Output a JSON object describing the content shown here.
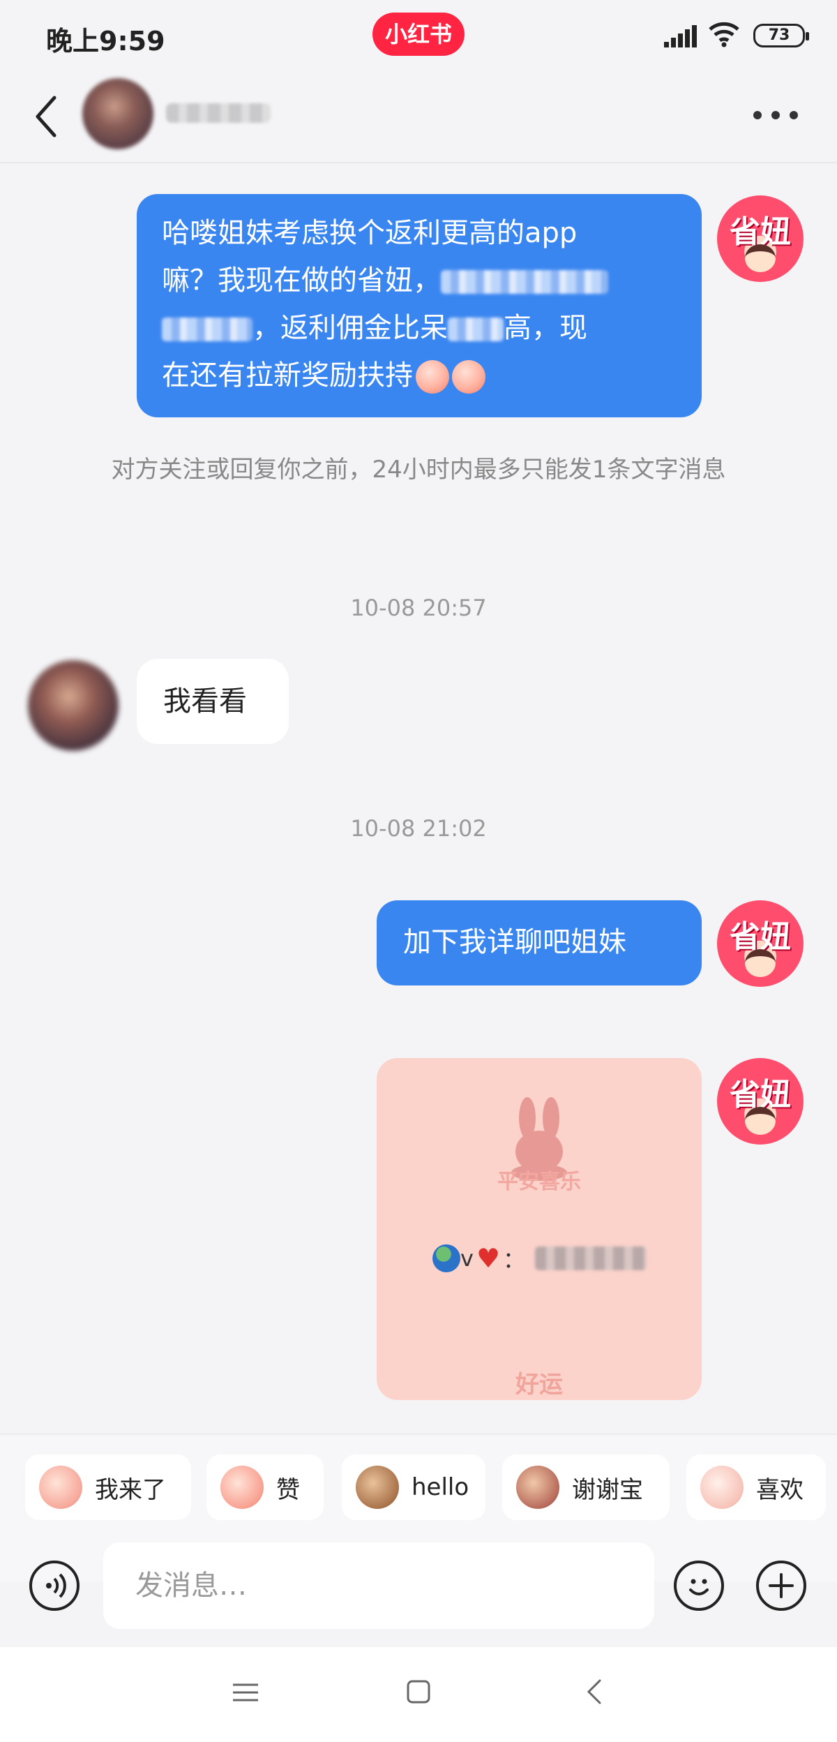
{
  "status_bar": {
    "time": "晚上9:59",
    "app_badge": "小红书",
    "battery": "73"
  },
  "header": {
    "avatar_icon": "avatar",
    "more_icon": "more-dots-icon"
  },
  "messages": {
    "msg1_line1": "哈喽姐妹考虑换个返利更高的app",
    "msg1_line2_a": "嘛？我现在做的省妞，",
    "msg1_line3_a": "，返利佣金比呆",
    "msg1_line3_b": "高，现",
    "msg1_line4": "在还有拉新奖励扶持",
    "notice": "对方关注或回复你之前，24小时内最多只能发1条文字消息",
    "time1": "10-08 20:57",
    "reply": "我看看",
    "time2": "10-08 21:02",
    "msg2": "加下我详聊吧姐妹",
    "card_caption": "平安喜乐",
    "card_v": "v",
    "card_colon": "：",
    "card_footer": "好运"
  },
  "my_avatar_text": "省妞",
  "quick_replies": [
    "我来了",
    "赞",
    "hello",
    "谢谢宝",
    "喜欢"
  ],
  "input": {
    "placeholder": "发消息…"
  },
  "colors": {
    "accent": "#3a86f0",
    "brand": "#ff2442",
    "background": "#f4f4f6"
  }
}
